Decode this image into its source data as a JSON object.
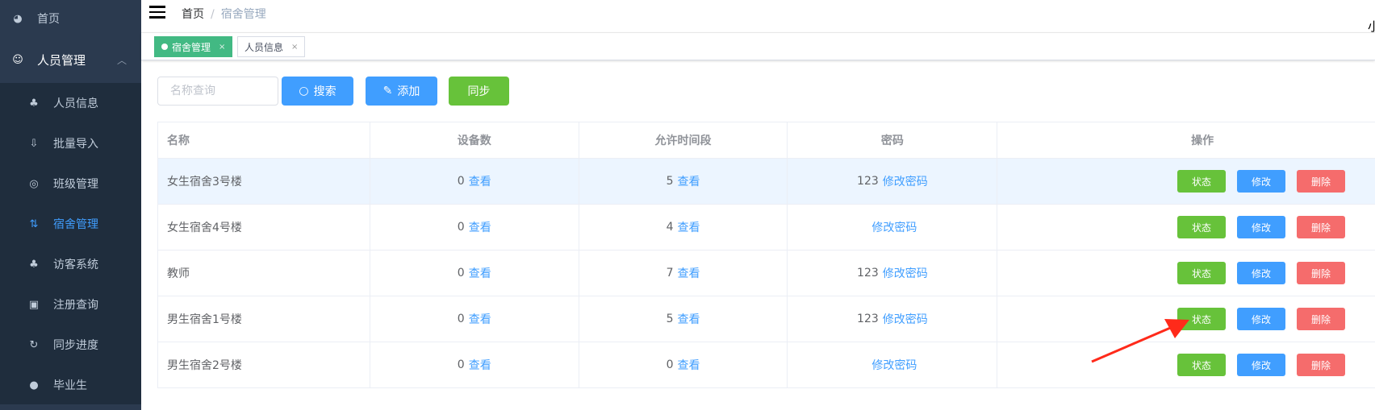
{
  "sidebar": {
    "home": {
      "label": "首页",
      "icon": "dashboard-icon"
    },
    "group": {
      "label": "人员管理",
      "icon": "user-group-icon",
      "expanded": true
    },
    "items": [
      {
        "label": "人员信息",
        "icon": "org-tree-icon",
        "active": false
      },
      {
        "label": "批量导入",
        "icon": "import-icon",
        "active": false
      },
      {
        "label": "班级管理",
        "icon": "class-icon",
        "active": false
      },
      {
        "label": "宿舍管理",
        "icon": "swap-icon",
        "active": true
      },
      {
        "label": "访客系统",
        "icon": "org-tree-icon",
        "active": false
      },
      {
        "label": "注册查询",
        "icon": "id-card-icon",
        "active": false
      },
      {
        "label": "同步进度",
        "icon": "refresh-icon",
        "active": false
      },
      {
        "label": "毕业生",
        "icon": "user-icon",
        "active": false
      }
    ]
  },
  "header": {
    "breadcrumb": [
      "首页",
      "宿舍管理"
    ],
    "separator": "/",
    "user": "小"
  },
  "tabs": [
    {
      "label": "宿舍管理",
      "active": true,
      "close": "×"
    },
    {
      "label": "人员信息",
      "active": false,
      "close": "×"
    }
  ],
  "toolbar": {
    "search_placeholder": "名称查询",
    "search_value": "",
    "search_label": "搜索",
    "add_label": "添加",
    "sync_label": "同步"
  },
  "table": {
    "columns": [
      "名称",
      "设备数",
      "允许时间段",
      "密码",
      "操作"
    ],
    "view_label": "查看",
    "change_password_label": "修改密码",
    "actions": {
      "status": "状态",
      "edit": "修改",
      "delete": "删除"
    },
    "rows": [
      {
        "name": "女生宿舍3号楼",
        "devices": "0",
        "periods": "5",
        "password": "123"
      },
      {
        "name": "女生宿舍4号楼",
        "devices": "0",
        "periods": "4",
        "password": ""
      },
      {
        "name": "教师",
        "devices": "0",
        "periods": "7",
        "password": "123"
      },
      {
        "name": "男生宿舍1号楼",
        "devices": "0",
        "periods": "5",
        "password": "123"
      },
      {
        "name": "男生宿舍2号楼",
        "devices": "0",
        "periods": "0",
        "password": ""
      }
    ]
  },
  "colors": {
    "sidebar_bg": "#1f2d3d",
    "active": "#409eff",
    "tab_active": "#42b983",
    "success": "#67c23a",
    "danger": "#f56c6c",
    "annotation_arrow": "#ff2a1a"
  }
}
